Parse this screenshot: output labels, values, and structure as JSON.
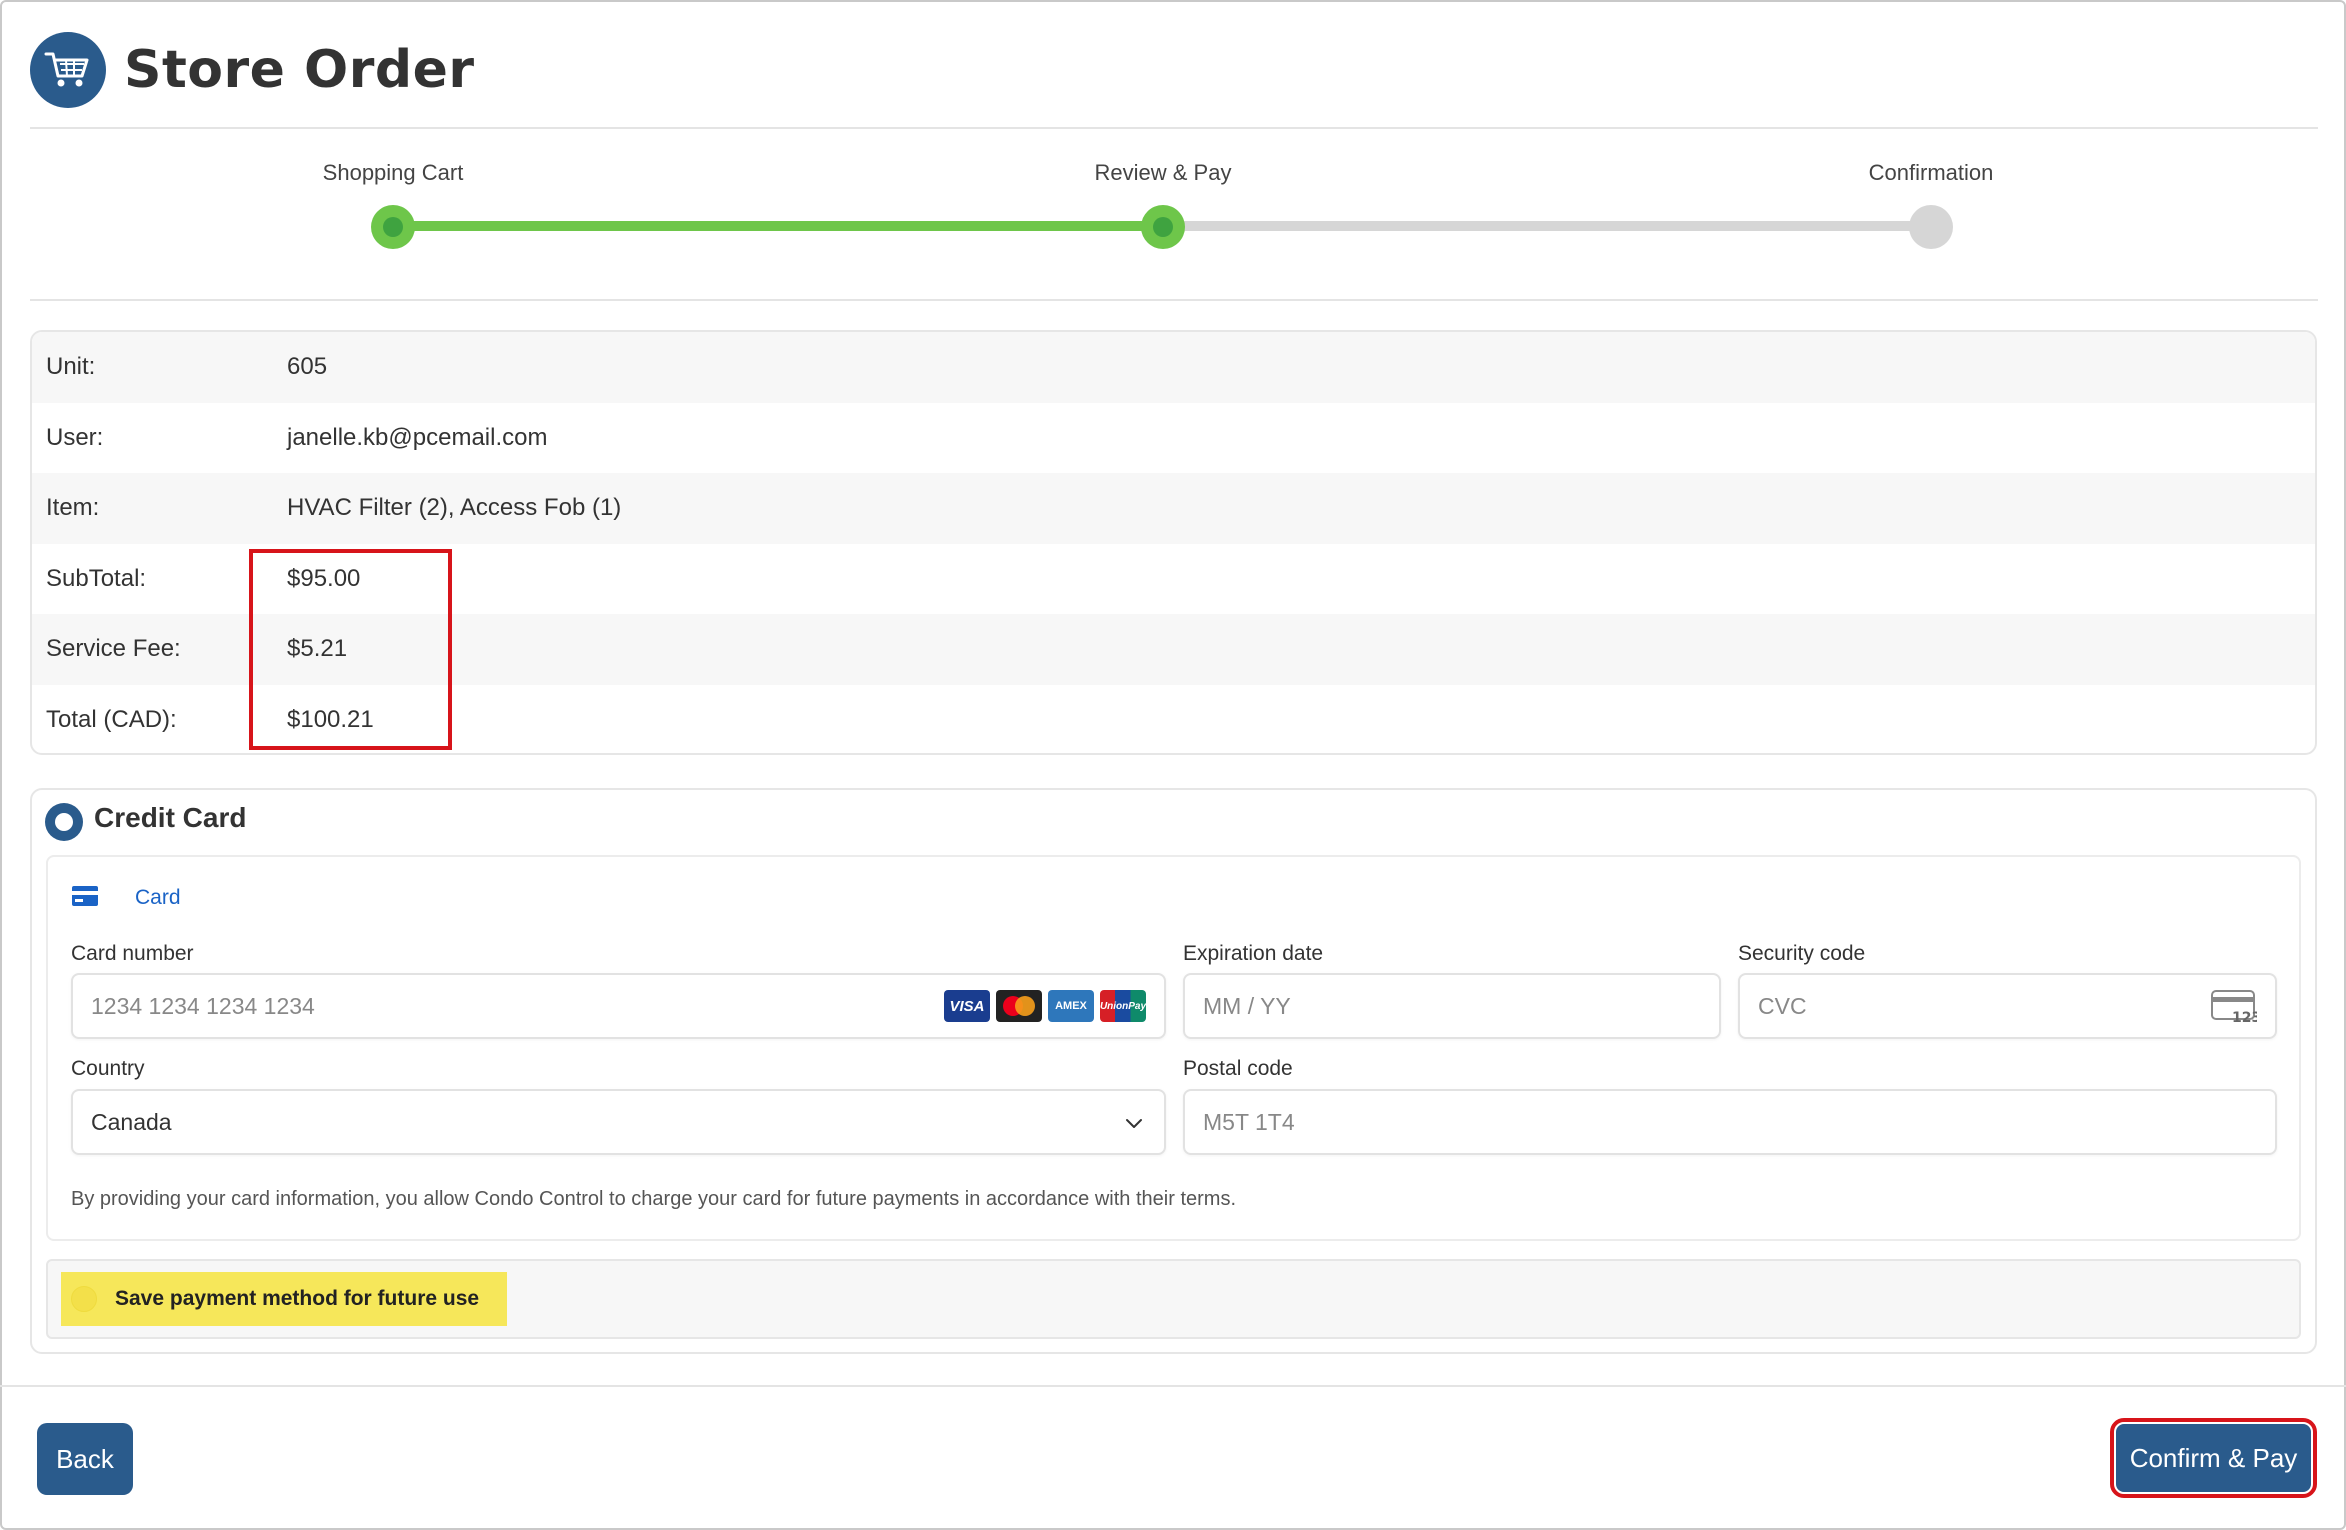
{
  "header": {
    "title": "Store Order",
    "logo_icon": "shopping-cart-icon"
  },
  "stepper": {
    "steps": [
      {
        "label": "Shopping Cart",
        "status": "done"
      },
      {
        "label": "Review & Pay",
        "status": "current"
      },
      {
        "label": "Confirmation",
        "status": "todo"
      }
    ]
  },
  "summary": {
    "rows": [
      {
        "label": "Unit:",
        "value": "605"
      },
      {
        "label": "User:",
        "value": "janelle.kb@pcemail.com"
      },
      {
        "label": "Item:",
        "value": "HVAC Filter (2), Access Fob (1)"
      },
      {
        "label": "SubTotal:",
        "value": "$95.00"
      },
      {
        "label": "Service Fee:",
        "value": "$5.21"
      },
      {
        "label": "Total (CAD):",
        "value": "$100.21"
      }
    ]
  },
  "payment": {
    "method_title": "Credit Card",
    "tab_label": "Card",
    "card_number": {
      "label": "Card number",
      "placeholder": "1234 1234 1234 1234"
    },
    "brands": [
      "VISA",
      "mastercard",
      "AMEX",
      "UnionPay"
    ],
    "expiration": {
      "label": "Expiration date",
      "placeholder": "MM / YY"
    },
    "security": {
      "label": "Security code",
      "placeholder": "CVC",
      "icon_text": "123"
    },
    "country": {
      "label": "Country",
      "value": "Canada"
    },
    "postal": {
      "label": "Postal code",
      "placeholder": "M5T 1T4"
    },
    "terms": "By providing your card information, you allow Condo Control to charge your card for future payments in accordance with their terms.",
    "save_label": "Save payment method for future use"
  },
  "footer": {
    "back_label": "Back",
    "confirm_label": "Confirm & Pay"
  },
  "colors": {
    "primary": "#2a5b8c",
    "progress": "#6ec64a",
    "highlight_red": "#d7141a",
    "highlight_yellow": "#f6e75a",
    "link": "#1a63c6"
  }
}
